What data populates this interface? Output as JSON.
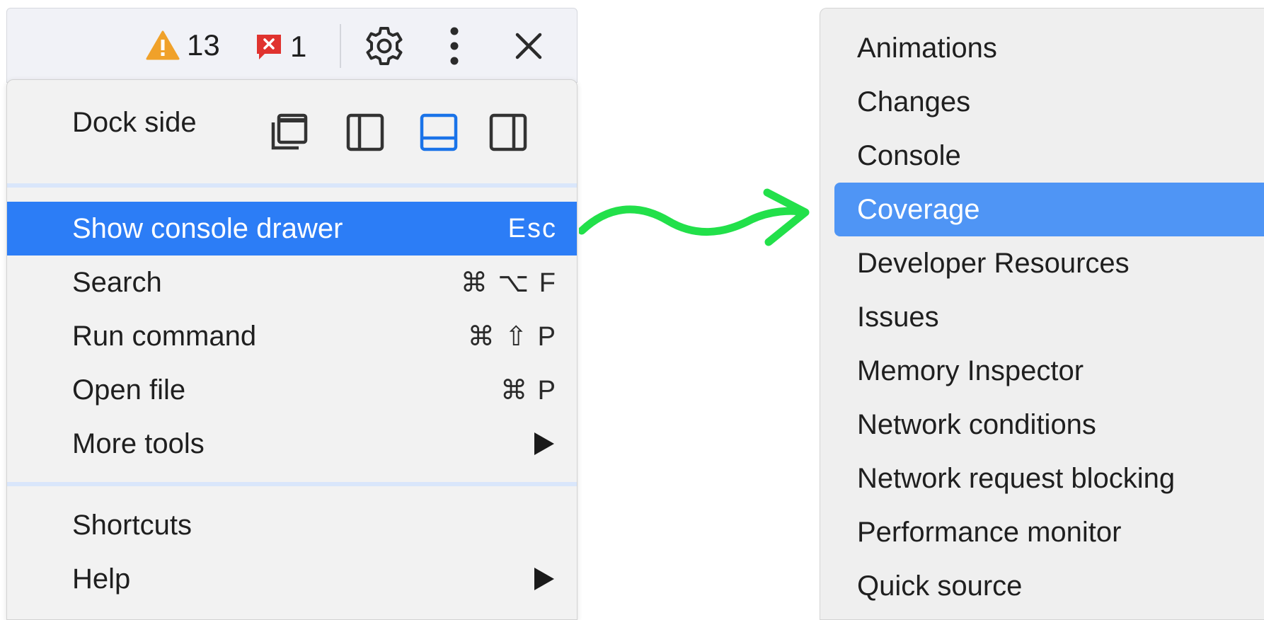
{
  "toolbar": {
    "warning_count": "13",
    "error_count": "1",
    "icons": {
      "warning": "warning-triangle-icon",
      "error": "error-badge-icon",
      "settings": "gear-icon",
      "more": "vertical-dots-icon",
      "close": "close-icon"
    }
  },
  "menu": {
    "dock_side_label": "Dock side",
    "dock_options": [
      "undock-icon",
      "dock-left-icon",
      "dock-bottom-icon",
      "dock-right-icon"
    ],
    "dock_selected": "dock-bottom-icon",
    "items": [
      {
        "label": "Show console drawer",
        "shortcut": "Esc"
      },
      {
        "label": "Search",
        "shortcut": "⌘ ⌥ F"
      },
      {
        "label": "Run command",
        "shortcut": "⌘ ⇧ P"
      },
      {
        "label": "Open file",
        "shortcut": "⌘ P"
      },
      {
        "label": "More tools",
        "shortcut": ""
      },
      {
        "label": "Shortcuts",
        "shortcut": ""
      },
      {
        "label": "Help",
        "shortcut": ""
      }
    ]
  },
  "more_tools": {
    "items": [
      "Animations",
      "Changes",
      "Console",
      "Coverage",
      "Developer Resources",
      "Issues",
      "Memory Inspector",
      "Network conditions",
      "Network request blocking",
      "Performance monitor",
      "Quick source"
    ],
    "highlighted": "Coverage"
  },
  "colors": {
    "highlight_left": "#2c7df6",
    "highlight_right": "#4f95f5",
    "arrow": "#22e04a",
    "warning": "#f0a12a",
    "error": "#e0332f",
    "dock_selected": "#1a73e8"
  }
}
